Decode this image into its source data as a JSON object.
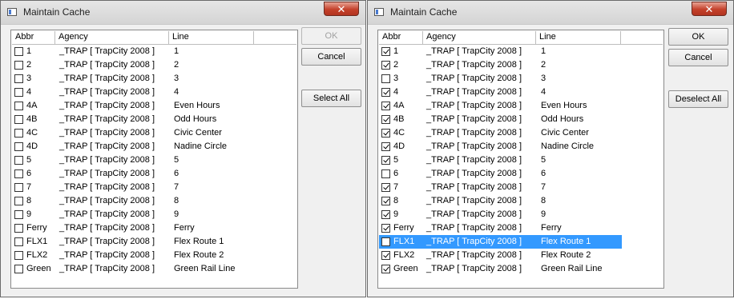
{
  "dialogs": [
    {
      "title": "Maintain Cache",
      "close_glyph": "✕",
      "columns": [
        "Abbr",
        "Agency",
        "Line"
      ],
      "buttons": {
        "ok": "OK",
        "cancel": "Cancel",
        "toggle": "Select All"
      },
      "ok_enabled": false,
      "rows": [
        {
          "abbr": "1",
          "agency": "_TRAP [ TrapCity 2008 ]",
          "line": "1",
          "checked": false
        },
        {
          "abbr": "2",
          "agency": "_TRAP [ TrapCity 2008 ]",
          "line": "2",
          "checked": false
        },
        {
          "abbr": "3",
          "agency": "_TRAP [ TrapCity 2008 ]",
          "line": "3",
          "checked": false
        },
        {
          "abbr": "4",
          "agency": "_TRAP [ TrapCity 2008 ]",
          "line": "4",
          "checked": false
        },
        {
          "abbr": "4A",
          "agency": "_TRAP [ TrapCity 2008 ]",
          "line": "Even Hours",
          "checked": false
        },
        {
          "abbr": "4B",
          "agency": "_TRAP [ TrapCity 2008 ]",
          "line": "Odd Hours",
          "checked": false
        },
        {
          "abbr": "4C",
          "agency": "_TRAP [ TrapCity 2008 ]",
          "line": "Civic Center",
          "checked": false
        },
        {
          "abbr": "4D",
          "agency": "_TRAP [ TrapCity 2008 ]",
          "line": "Nadine Circle",
          "checked": false
        },
        {
          "abbr": "5",
          "agency": "_TRAP [ TrapCity 2008 ]",
          "line": "5",
          "checked": false
        },
        {
          "abbr": "6",
          "agency": "_TRAP [ TrapCity 2008 ]",
          "line": "6",
          "checked": false
        },
        {
          "abbr": "7",
          "agency": "_TRAP [ TrapCity 2008 ]",
          "line": "7",
          "checked": false
        },
        {
          "abbr": "8",
          "agency": "_TRAP [ TrapCity 2008 ]",
          "line": "8",
          "checked": false
        },
        {
          "abbr": "9",
          "agency": "_TRAP [ TrapCity 2008 ]",
          "line": "9",
          "checked": false
        },
        {
          "abbr": "Ferry",
          "agency": "_TRAP [ TrapCity 2008 ]",
          "line": "Ferry",
          "checked": false
        },
        {
          "abbr": "FLX1",
          "agency": "_TRAP [ TrapCity 2008 ]",
          "line": "Flex Route 1",
          "checked": false
        },
        {
          "abbr": "FLX2",
          "agency": "_TRAP [ TrapCity 2008 ]",
          "line": "Flex Route 2",
          "checked": false
        },
        {
          "abbr": "Green",
          "agency": "_TRAP [ TrapCity 2008 ]",
          "line": "Green Rail Line",
          "checked": false
        }
      ]
    },
    {
      "title": "Maintain Cache",
      "close_glyph": "✕",
      "columns": [
        "Abbr",
        "Agency",
        "Line"
      ],
      "buttons": {
        "ok": "OK",
        "cancel": "Cancel",
        "toggle": "Deselect All"
      },
      "ok_enabled": true,
      "rows": [
        {
          "abbr": "1",
          "agency": "_TRAP [ TrapCity 2008 ]",
          "line": "1",
          "checked": true
        },
        {
          "abbr": "2",
          "agency": "_TRAP [ TrapCity 2008 ]",
          "line": "2",
          "checked": true
        },
        {
          "abbr": "3",
          "agency": "_TRAP [ TrapCity 2008 ]",
          "line": "3",
          "checked": false
        },
        {
          "abbr": "4",
          "agency": "_TRAP [ TrapCity 2008 ]",
          "line": "4",
          "checked": true
        },
        {
          "abbr": "4A",
          "agency": "_TRAP [ TrapCity 2008 ]",
          "line": "Even Hours",
          "checked": true
        },
        {
          "abbr": "4B",
          "agency": "_TRAP [ TrapCity 2008 ]",
          "line": "Odd Hours",
          "checked": true
        },
        {
          "abbr": "4C",
          "agency": "_TRAP [ TrapCity 2008 ]",
          "line": "Civic Center",
          "checked": true
        },
        {
          "abbr": "4D",
          "agency": "_TRAP [ TrapCity 2008 ]",
          "line": "Nadine Circle",
          "checked": true
        },
        {
          "abbr": "5",
          "agency": "_TRAP [ TrapCity 2008 ]",
          "line": "5",
          "checked": true
        },
        {
          "abbr": "6",
          "agency": "_TRAP [ TrapCity 2008 ]",
          "line": "6",
          "checked": false
        },
        {
          "abbr": "7",
          "agency": "_TRAP [ TrapCity 2008 ]",
          "line": "7",
          "checked": true
        },
        {
          "abbr": "8",
          "agency": "_TRAP [ TrapCity 2008 ]",
          "line": "8",
          "checked": true
        },
        {
          "abbr": "9",
          "agency": "_TRAP [ TrapCity 2008 ]",
          "line": "9",
          "checked": true
        },
        {
          "abbr": "Ferry",
          "agency": "_TRAP [ TrapCity 2008 ]",
          "line": "Ferry",
          "checked": true
        },
        {
          "abbr": "FLX1",
          "agency": "_TRAP [ TrapCity 2008 ]",
          "line": "Flex Route 1",
          "checked": false,
          "selected": true
        },
        {
          "abbr": "FLX2",
          "agency": "_TRAP [ TrapCity 2008 ]",
          "line": "Flex Route 2",
          "checked": true
        },
        {
          "abbr": "Green",
          "agency": "_TRAP [ TrapCity 2008 ]",
          "line": "Green Rail Line",
          "checked": true
        }
      ]
    }
  ],
  "colors": {
    "selection": "#3399ff",
    "close_button": "#c4412a"
  }
}
